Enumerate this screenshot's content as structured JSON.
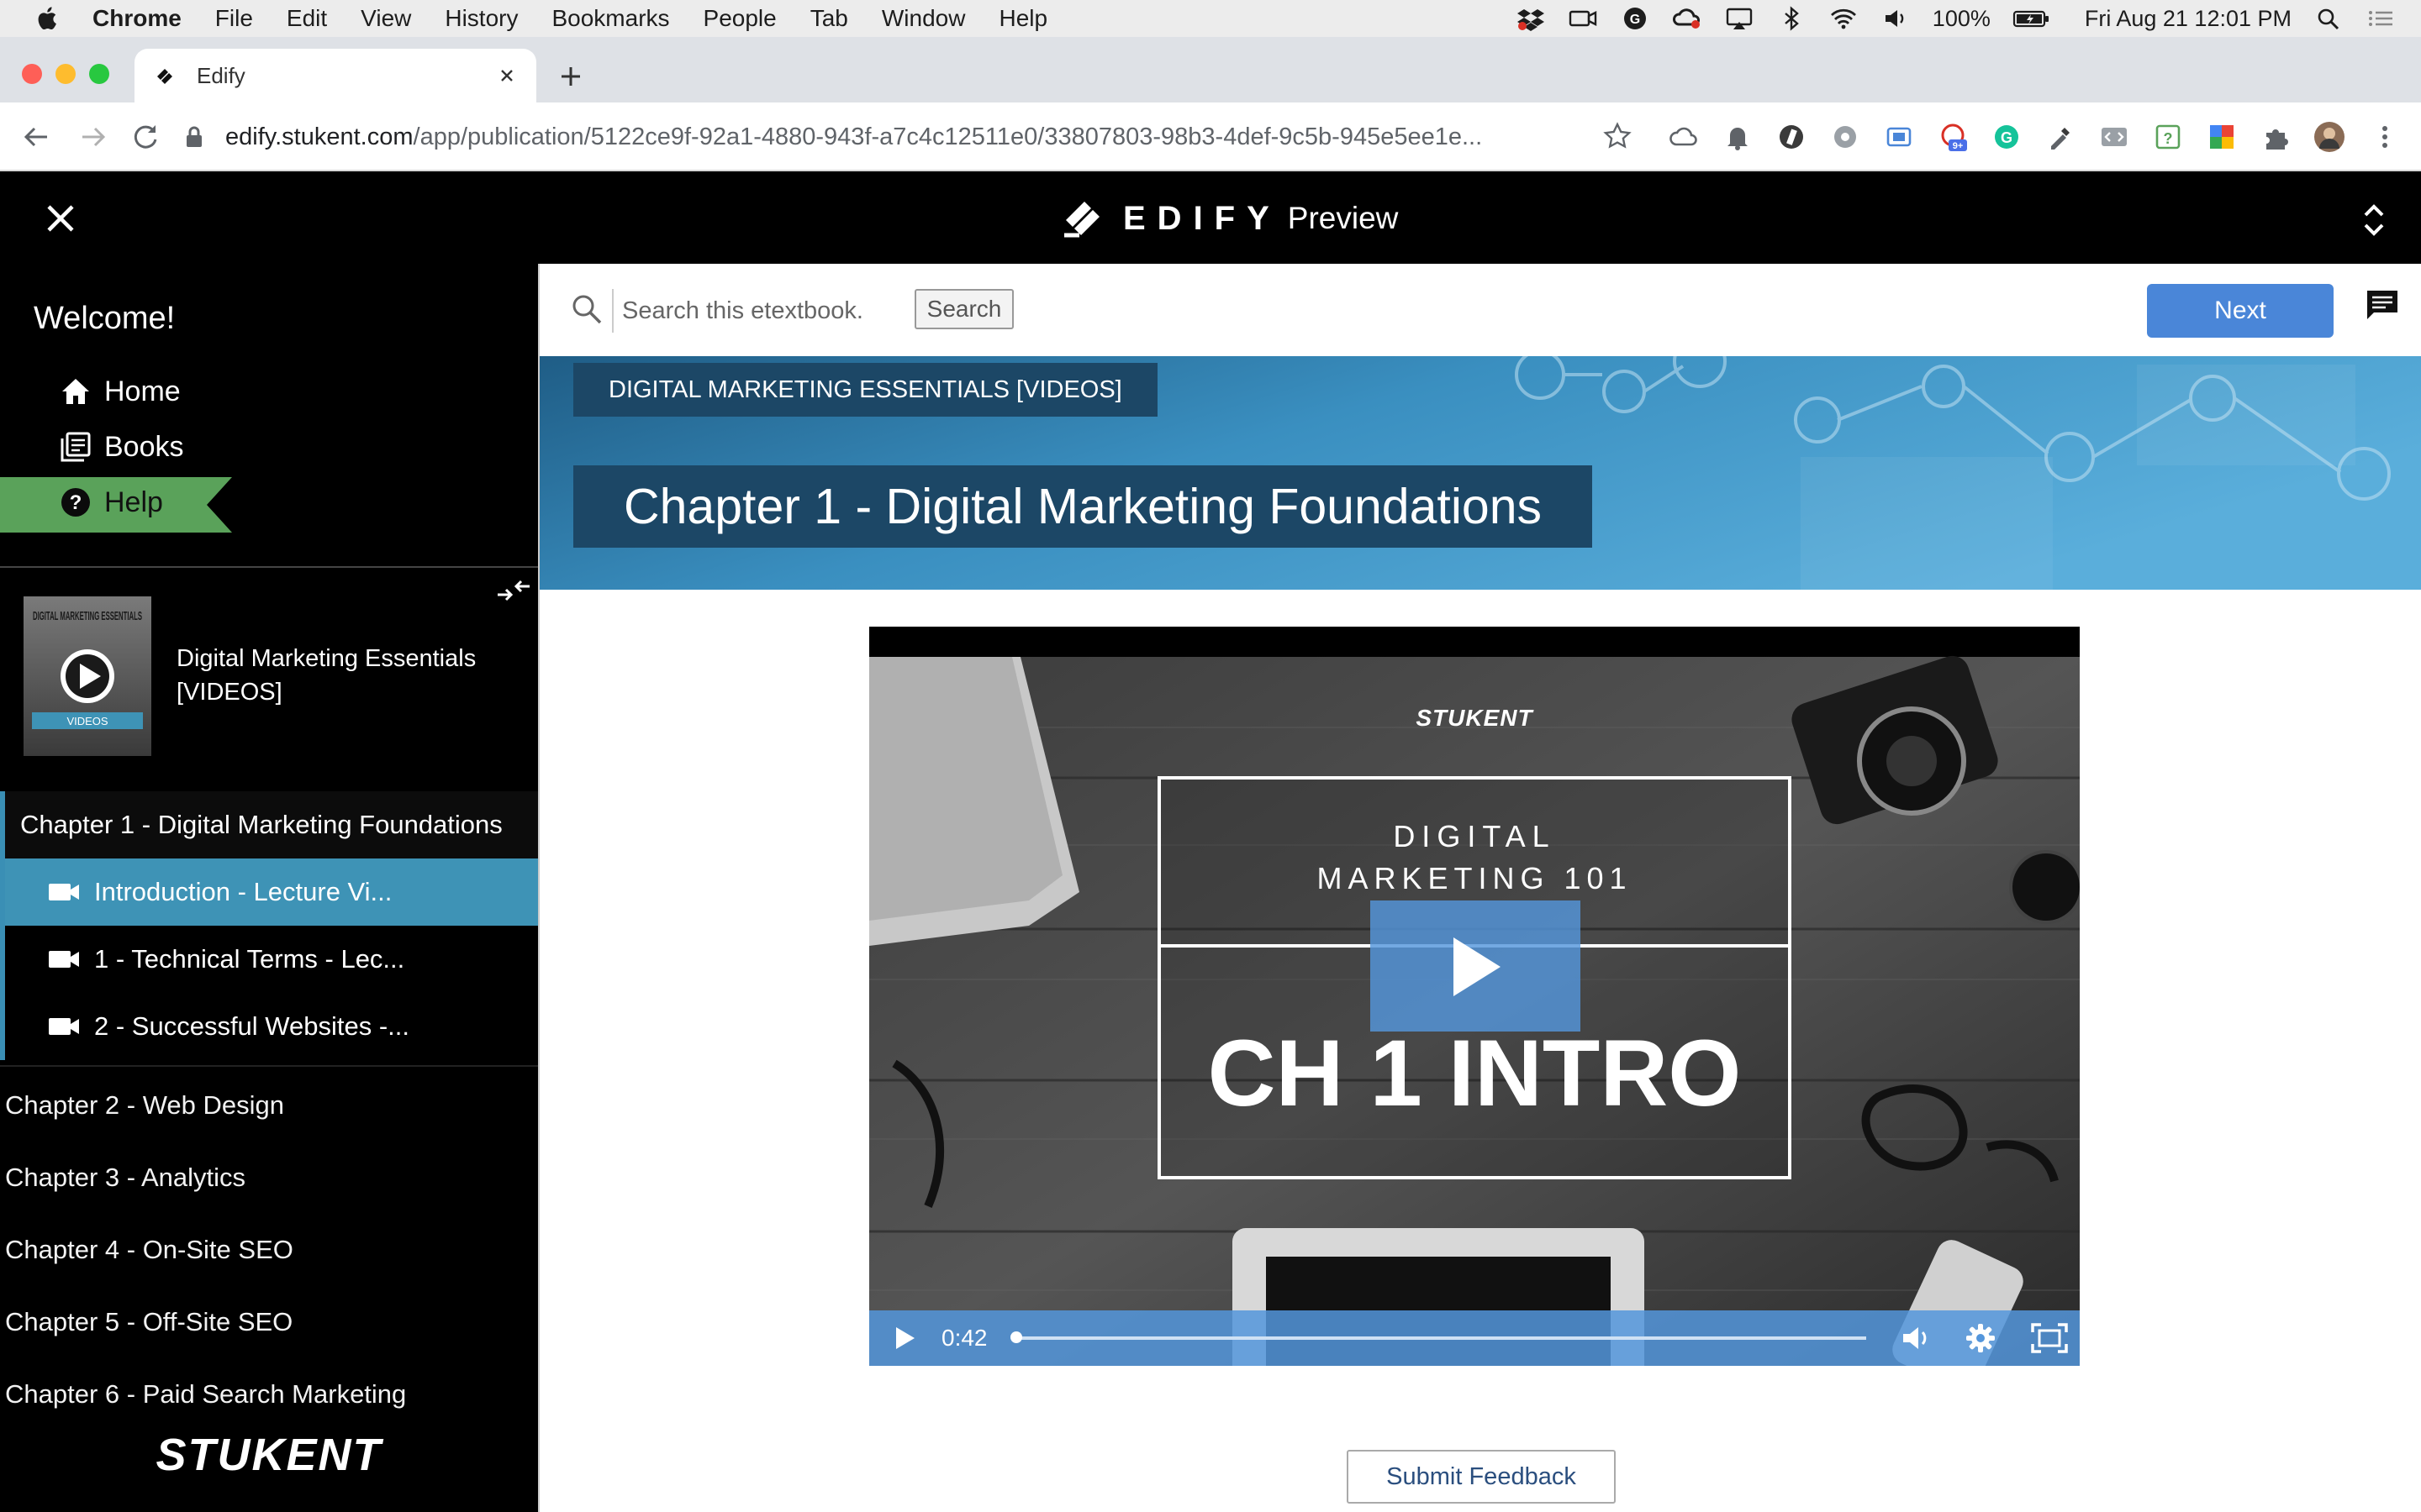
{
  "menubar": {
    "app_name": "Chrome",
    "items": [
      "File",
      "Edit",
      "View",
      "History",
      "Bookmarks",
      "People",
      "Tab",
      "Window",
      "Help"
    ],
    "battery": "100%",
    "datetime": "Fri Aug 21  12:01 PM"
  },
  "browser": {
    "tab_title": "Edify",
    "url_host": "edify.stukent.com",
    "url_path": "/app/publication/5122ce9f-92a1-4880-943f-a7c4c12511e0/33807803-98b3-4def-9c5b-945e5ee1e...",
    "extension_badge": "9+"
  },
  "header": {
    "logo_text": "EDIFY",
    "mode_label": "Preview"
  },
  "sidebar": {
    "welcome": "Welcome!",
    "nav": [
      {
        "label": "Home",
        "icon": "home-icon"
      },
      {
        "label": "Books",
        "icon": "books-icon"
      },
      {
        "label": "Help",
        "icon": "help-icon"
      }
    ],
    "book": {
      "title": "Digital Marketing Essentials [VIDEOS]",
      "cover_title": "DIGITAL MARKETING ESSENTIALS",
      "cover_label": "VIDEOS"
    },
    "active_chapter": "Chapter 1 - Digital Marketing Foundations",
    "sections": [
      "Introduction - Lecture Vi...",
      "1 - Technical Terms - Lec...",
      "2 - Successful Websites -..."
    ],
    "chapters": [
      "Chapter 2 - Web Design",
      "Chapter 3 - Analytics",
      "Chapter 4 - On-Site SEO",
      "Chapter 5 - Off-Site SEO",
      "Chapter 6 - Paid Search Marketing"
    ],
    "footer_logo": "STUKENT"
  },
  "main": {
    "search_placeholder": "Search this etextbook...",
    "search_button": "Search",
    "next_button": "Next",
    "banner_tag": "DIGITAL MARKETING ESSENTIALS [VIDEOS]",
    "banner_title": "Chapter 1 - Digital Marketing Foundations",
    "video": {
      "brand": "STUKENT",
      "line1": "DIGITAL",
      "line2": "MARKETING 101",
      "big_title": "CH 1 INTRO",
      "time": "0:42",
      "progress": 0.0
    },
    "feedback_button": "Submit Feedback"
  },
  "colors": {
    "accent_blue": "#4a86d8",
    "sidebar_active": "#3e93b6",
    "help_green": "#5aa25a",
    "banner_dark": "#1c4766"
  }
}
